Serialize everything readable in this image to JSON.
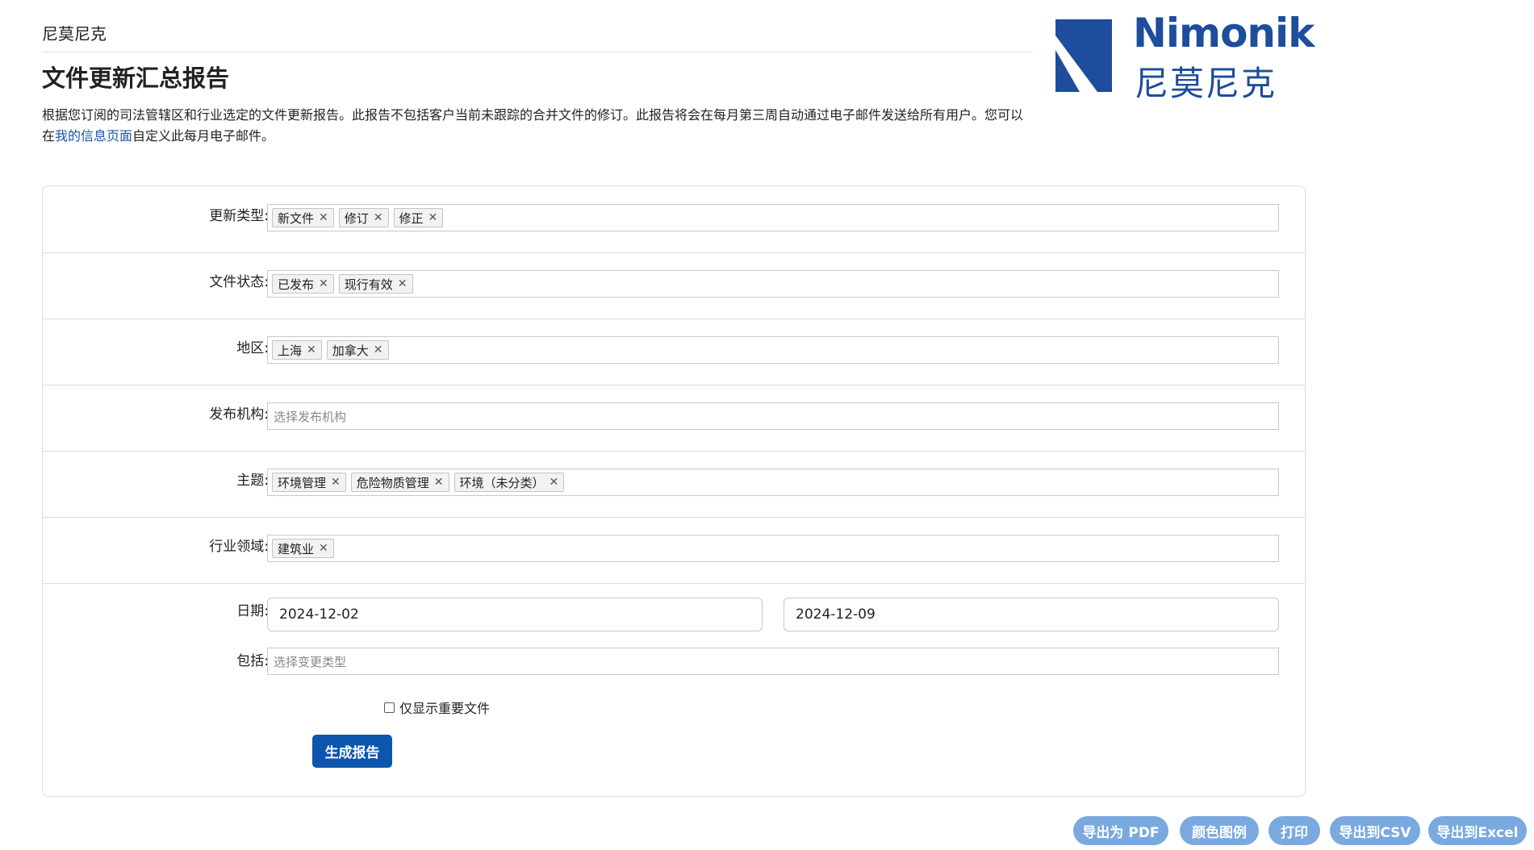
{
  "header": {
    "brand": "尼莫尼克",
    "title": "文件更新汇总报告",
    "intro_before": "根据您订阅的司法管辖区和行业选定的文件更新报告。此报告不包括客户当前未跟踪的合并文件的修订。此报告将会在每月第三周自动通过电子邮件发送给所有用户。您可以在",
    "intro_link": "我的信息页面",
    "intro_after": "自定义此每月电子邮件。"
  },
  "logo": {
    "text_en": "Nimonik",
    "text_cn": "尼莫尼克",
    "color": "#1d4d9c"
  },
  "form": {
    "update_type": {
      "label": "更新类型:",
      "tags": [
        "新文件",
        "修订",
        "修正"
      ]
    },
    "doc_status": {
      "label": "文件状态:",
      "tags": [
        "已发布",
        "现行有效"
      ]
    },
    "region": {
      "label": "地区:",
      "tags": [
        "上海",
        "加拿大"
      ]
    },
    "publisher": {
      "label": "发布机构:",
      "placeholder": "选择发布机构"
    },
    "topic": {
      "label": "主题:",
      "tags": [
        "环境管理",
        "危险物质管理",
        "环境（未分类）"
      ]
    },
    "industry": {
      "label": "行业领域:",
      "tags": [
        "建筑业"
      ]
    },
    "date": {
      "label": "日期:",
      "start": "2024-12-02",
      "end": "2024-12-09"
    },
    "include": {
      "label": "包括:",
      "placeholder": "选择变更类型"
    },
    "important_only": {
      "label": "仅显示重要文件",
      "checked": false
    },
    "generate_label": "生成报告"
  },
  "actions": {
    "export_pdf": "导出为 PDF",
    "color_legend": "颜色图例",
    "print": "打印",
    "export_csv": "导出到CSV",
    "export_excel": "导出到Excel"
  },
  "tag_remove_glyph": "✕",
  "colors": {
    "primary": "#0d56ad",
    "secondary_btn": "#79a9df",
    "link": "#1a55a8"
  }
}
